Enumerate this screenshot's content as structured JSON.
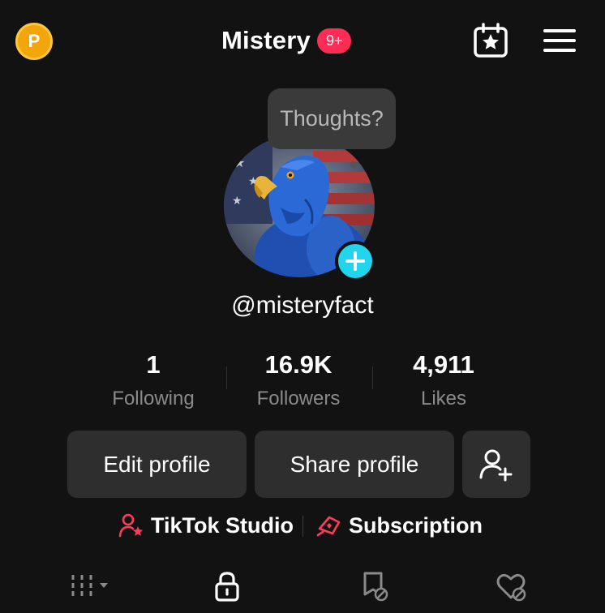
{
  "header": {
    "coin_label": "P",
    "title": "Mistery",
    "notification_badge": "9+"
  },
  "profile": {
    "bubble_text": "Thoughts?",
    "handle": "@misteryfact"
  },
  "stats": [
    {
      "value": "1",
      "label": "Following"
    },
    {
      "value": "16.9K",
      "label": "Followers"
    },
    {
      "value": "4,911",
      "label": "Likes"
    }
  ],
  "actions": {
    "edit_label": "Edit profile",
    "share_label": "Share profile"
  },
  "links": {
    "studio_label": "TikTok Studio",
    "subscription_label": "Subscription"
  },
  "tabs": [
    "grid-filter-icon",
    "lock-icon",
    "repost-hidden-icon",
    "liked-hidden-icon"
  ],
  "colors": {
    "background": "#121212",
    "badge": "#ff2c55",
    "accent_cyan": "#20d5ec",
    "coin": "#f2a60c",
    "button_bg": "#2e2e2e",
    "secondary_text": "#8a8a8a"
  }
}
